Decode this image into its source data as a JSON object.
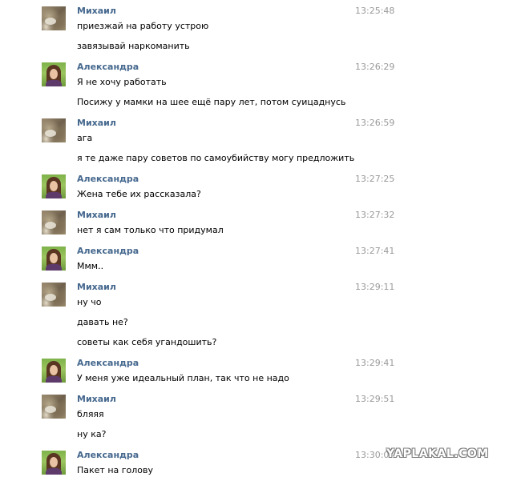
{
  "messages": [
    {
      "author": "Михаил",
      "avatar": "mikhail",
      "time": "13:25:48",
      "lines": [
        "приезжай на работу устрою",
        "завязывай наркоманить"
      ]
    },
    {
      "author": "Александра",
      "avatar": "alexandra",
      "time": "13:26:29",
      "lines": [
        "Я не хочу работать",
        "Посижу у мамки на шее ещё пару лет, потом суицаднусь"
      ]
    },
    {
      "author": "Михаил",
      "avatar": "mikhail",
      "time": "13:26:59",
      "lines": [
        "ага",
        "я те даже пару советов по самоубийству могу предложить"
      ]
    },
    {
      "author": "Александра",
      "avatar": "alexandra",
      "time": "13:27:25",
      "lines": [
        "Жена тебе их рассказала?"
      ]
    },
    {
      "author": "Михаил",
      "avatar": "mikhail",
      "time": "13:27:32",
      "lines": [
        "нет я сам только что придумал"
      ]
    },
    {
      "author": "Александра",
      "avatar": "alexandra",
      "time": "13:27:41",
      "lines": [
        "Ммм.."
      ]
    },
    {
      "author": "Михаил",
      "avatar": "mikhail",
      "time": "13:29:11",
      "lines": [
        "ну чо",
        "давать не?",
        "советы как себя угандошить?"
      ]
    },
    {
      "author": "Александра",
      "avatar": "alexandra",
      "time": "13:29:41",
      "lines": [
        "У меня уже идеальный план, так что не надо"
      ]
    },
    {
      "author": "Михаил",
      "avatar": "mikhail",
      "time": "13:29:51",
      "lines": [
        "бляяя",
        "ну ка?"
      ]
    },
    {
      "author": "Александра",
      "avatar": "alexandra",
      "time": "13:30:0",
      "lines": [
        "Пакет на голову"
      ]
    }
  ],
  "watermark": "YAPLAKAL.COM",
  "colors": {
    "author_name": "#45688e",
    "timestamp": "#999999",
    "message_text": "#000000",
    "background": "#ffffff"
  }
}
